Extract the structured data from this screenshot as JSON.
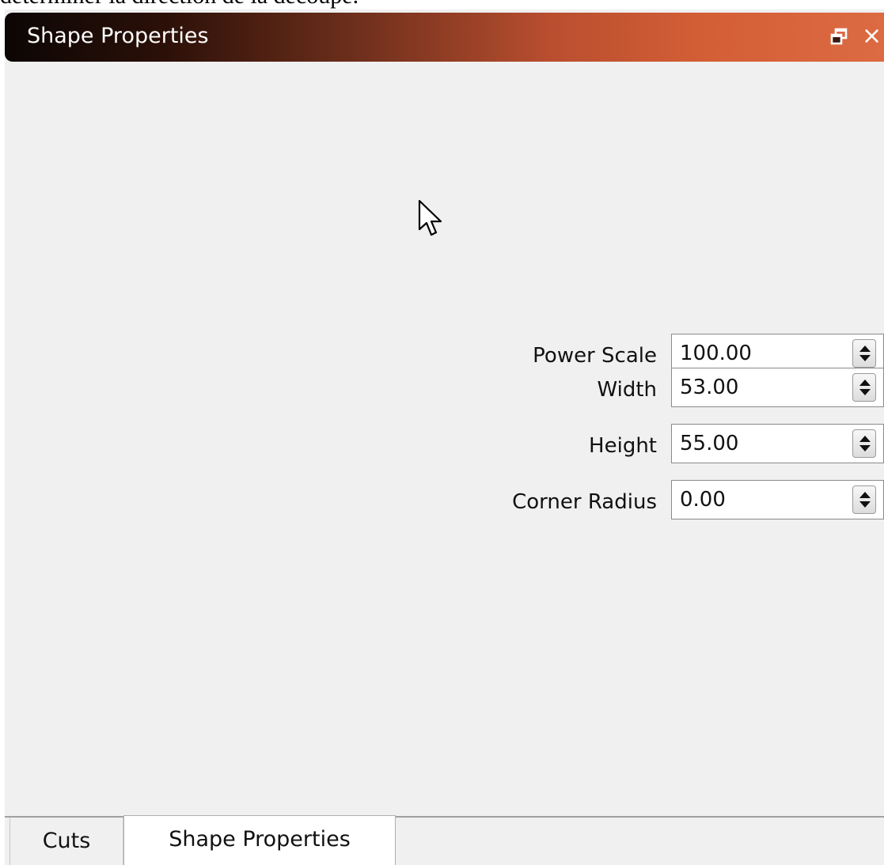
{
  "document": {
    "fragment_text": "déterminer la direction de la découpe."
  },
  "panel": {
    "title": "Shape Properties",
    "float_icon": "float-window-icon",
    "close_label": "×",
    "title_gradient": [
      "#0c0605",
      "#dc6a42"
    ],
    "background": "#f0f0f0"
  },
  "properties": [
    {
      "label": "Power Scale",
      "value": "100.00"
    },
    {
      "label": "Width",
      "value": "53.00"
    },
    {
      "label": "Height",
      "value": "55.00"
    },
    {
      "label": "Corner Radius",
      "value": "0.00"
    }
  ],
  "tabs": [
    {
      "label": "Cuts",
      "active": false
    },
    {
      "label": "Shape Properties",
      "active": true
    }
  ],
  "cursor": {
    "icon": "mouse-pointer-icon"
  }
}
